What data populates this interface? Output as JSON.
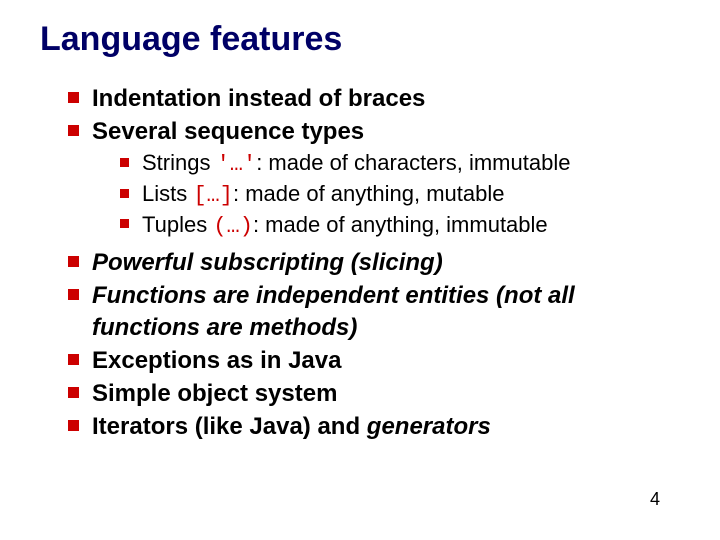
{
  "title": "Language features",
  "bullets": {
    "b0": "Indentation instead of braces",
    "b1": "Several sequence types",
    "b2": "Powerful subscripting (slicing)",
    "b3": "Functions are independent entities (not all functions are methods)",
    "b4": "Exceptions as in Java",
    "b5": "Simple object system",
    "b6_pre": "Iterators (like Java) and ",
    "b6_em": "generators"
  },
  "sub": {
    "s0_pre": "Strings ",
    "s0_code": "'…'",
    "s0_post": ": made of characters, immutable",
    "s1_pre": "Lists ",
    "s1_code": "[…]",
    "s1_post": ": made of anything, mutable",
    "s2_pre": "Tuples ",
    "s2_code": "(…)",
    "s2_post": ": made of anything, immutable"
  },
  "pageNumber": "4"
}
